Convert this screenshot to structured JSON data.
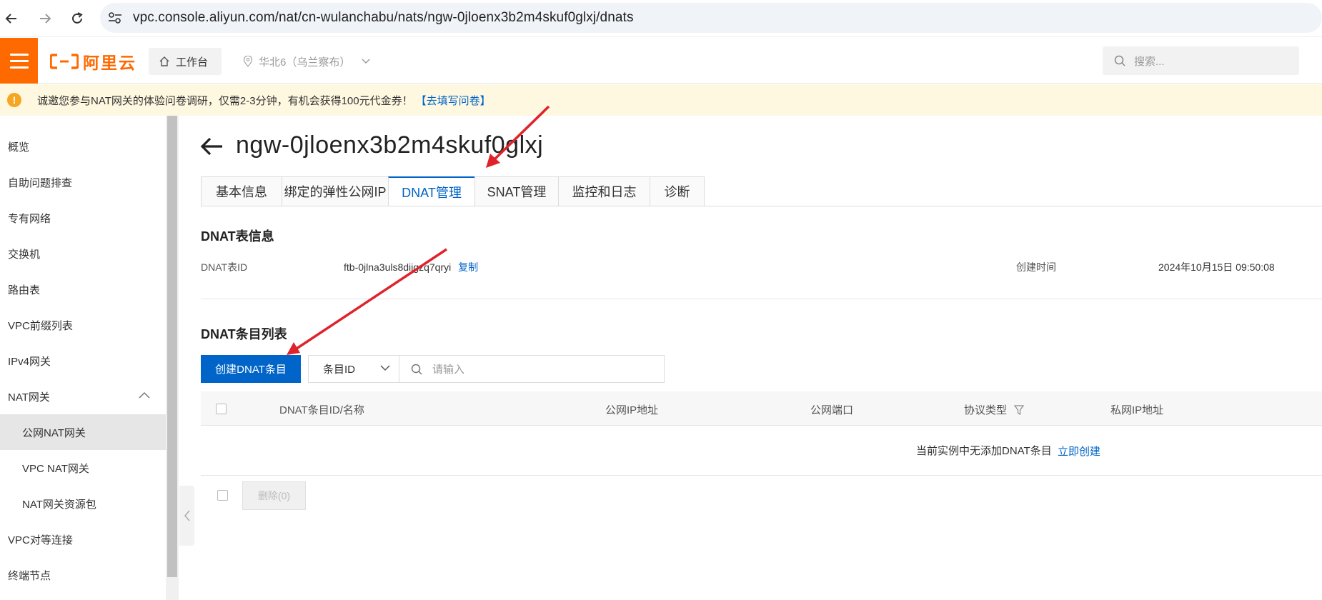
{
  "browser": {
    "url": "vpc.console.aliyun.com/nat/cn-wulanchabu/nats/ngw-0jloenx3b2m4skuf0glxj/dnats"
  },
  "topbar": {
    "brand": "阿里云",
    "workbench_label": "工作台",
    "region_label": "华北6（乌兰察布）",
    "search_placeholder": "搜索..."
  },
  "notice": {
    "text": "诚邀您参与NAT网关的体验问卷调研，仅需2-3分钟，有机会获得100元代金券！",
    "link": "【去填写问卷】"
  },
  "sidebar": {
    "items": [
      {
        "label": "概览"
      },
      {
        "label": "自助问题排查"
      },
      {
        "label": "专有网络"
      },
      {
        "label": "交换机"
      },
      {
        "label": "路由表"
      },
      {
        "label": "VPC前缀列表"
      },
      {
        "label": "IPv4网关"
      },
      {
        "label": "NAT网关"
      },
      {
        "label": "公网NAT网关"
      },
      {
        "label": "VPC NAT网关"
      },
      {
        "label": "NAT网关资源包"
      },
      {
        "label": "VPC对等连接"
      },
      {
        "label": "终端节点"
      }
    ]
  },
  "page": {
    "title": "ngw-0jloenx3b2m4skuf0glxj",
    "tabs": [
      {
        "label": "基本信息"
      },
      {
        "label": "绑定的弹性公网IP"
      },
      {
        "label": "DNAT管理"
      },
      {
        "label": "SNAT管理"
      },
      {
        "label": "监控和日志"
      },
      {
        "label": "诊断"
      }
    ],
    "active_tab": "DNAT管理"
  },
  "dnat_info": {
    "section_title": "DNAT表信息",
    "id_label": "DNAT表ID",
    "id_value": "ftb-0jlna3uls8dii",
    "id_value_tail": "gzq7qryi",
    "copy_label": "复制",
    "created_label": "创建时间",
    "created_value": "2024年10月15日 09:50:08"
  },
  "dnat_list": {
    "section_title": "DNAT条目列表",
    "create_button": "创建DNAT条目",
    "filter_field": "条目ID",
    "filter_placeholder": "请输入",
    "columns": [
      "DNAT条目ID/名称",
      "公网IP地址",
      "公网端口",
      "协议类型",
      "私网IP地址"
    ],
    "empty_text": "当前实例中无添加DNAT条目",
    "empty_link": "立即创建",
    "delete_button": "删除(0)"
  },
  "colors": {
    "brand_orange": "#ff6a00",
    "primary_blue": "#0064c8",
    "annotation_red": "#e0232b"
  }
}
